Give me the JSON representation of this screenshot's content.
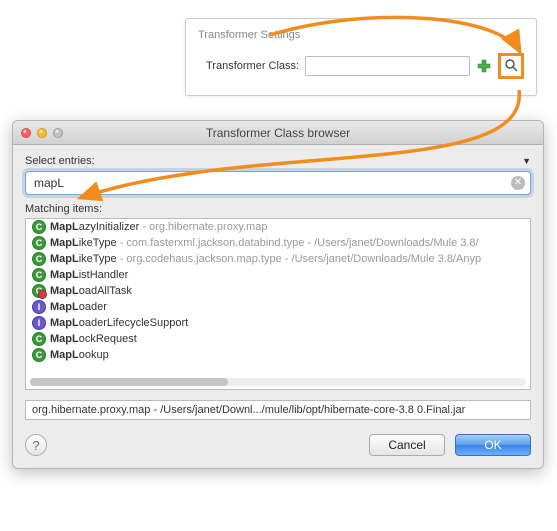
{
  "settings": {
    "title": "Transformer Settings",
    "field_label": "Transformer Class:",
    "field_value": ""
  },
  "dialog": {
    "title": "Transformer Class browser",
    "select_label": "Select entries:",
    "search_value": "mapL",
    "matching_label": "Matching items:",
    "items": [
      {
        "icon": "c",
        "bold": "MapL",
        "rest": "azyInitializer",
        "ext": " - org.hibernate.proxy.map"
      },
      {
        "icon": "c",
        "bold": "MapL",
        "rest": "ikeType",
        "ext": " - com.fasterxml.jackson.databind.type - /Users/janet/Downloads/Mule 3.8/"
      },
      {
        "icon": "c",
        "bold": "MapL",
        "rest": "ikeType",
        "ext": " - org.codehaus.jackson.map.type - /Users/janet/Downloads/Mule 3.8/Anyp"
      },
      {
        "icon": "c",
        "bold": "MapL",
        "rest": "istHandler",
        "ext": ""
      },
      {
        "icon": "g",
        "bold": "MapL",
        "rest": "oadAllTask",
        "ext": ""
      },
      {
        "icon": "i",
        "bold": "MapL",
        "rest": "oader",
        "ext": ""
      },
      {
        "icon": "i",
        "bold": "MapL",
        "rest": "oaderLifecycleSupport",
        "ext": ""
      },
      {
        "icon": "c",
        "bold": "MapL",
        "rest": "ockRequest",
        "ext": ""
      },
      {
        "icon": "c",
        "bold": "MapL",
        "rest": "ookup",
        "ext": ""
      }
    ],
    "path": "org.hibernate.proxy.map - /Users/janet/Downl.../mule/lib/opt/hibernate-core-3.8 0.Final.jar",
    "cancel_label": "Cancel",
    "ok_label": "OK"
  }
}
